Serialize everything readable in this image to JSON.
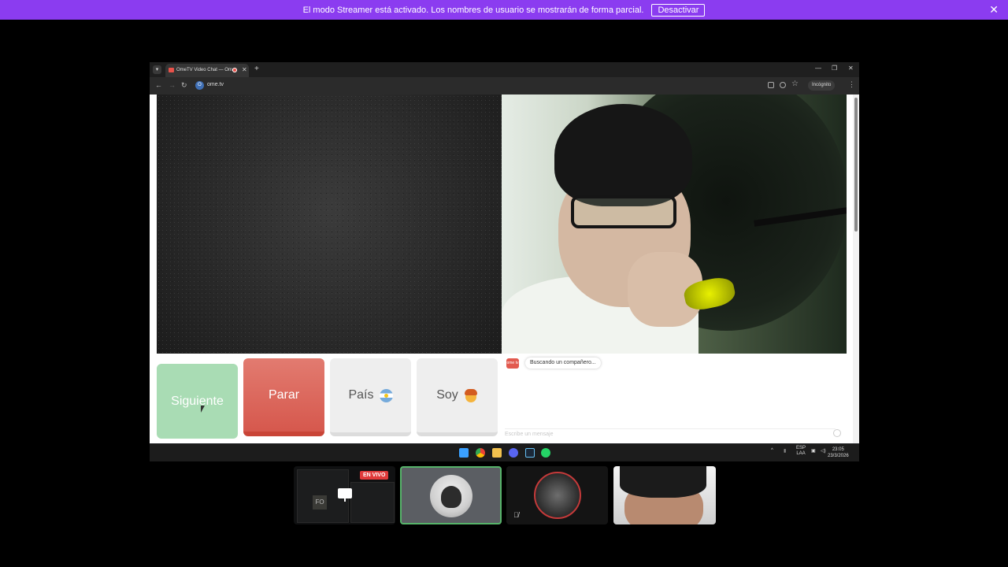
{
  "banner": {
    "message": "El modo Streamer está activado. Los nombres de usuario se mostrarán de forma parcial.",
    "deactivate_label": "Desactivar",
    "close_icon": "✕"
  },
  "browser": {
    "tab_title": "OmeTV Video Chat — Ome",
    "url": "ome.tv",
    "incognito_label": "Incógnito",
    "site_icon": "O"
  },
  "controls": {
    "next_label": "Siguiente",
    "stop_label": "Parar",
    "country_label": "País",
    "gender_label": "Soy"
  },
  "chat": {
    "logo_text": "ome tv",
    "status_message": "Buscando un compañero...",
    "input_placeholder": "Escribe un mensaje"
  },
  "taskbar": {
    "lang_top": "ESP",
    "lang_bottom": "LAA",
    "time": "23:05",
    "date": "23/3/2026"
  },
  "participants": {
    "live_badge": "EN VIVO",
    "screen_tile_text": "FO"
  },
  "colors": {
    "banner": "#8b3cf0",
    "next": "#a9dcb4",
    "stop": "#d6584d",
    "active_speaker": "#57b36a",
    "live": "#e03a3a"
  }
}
